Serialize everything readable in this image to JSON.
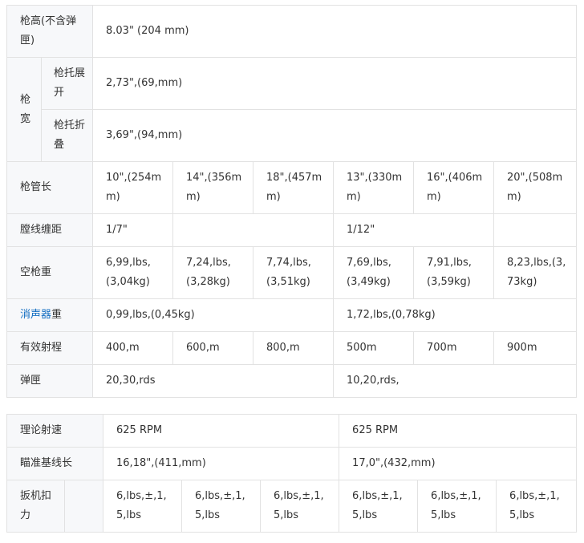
{
  "table1": {
    "height": {
      "label": "枪高(不含弹匣)",
      "value": "8.03\" (204 mm)"
    },
    "width": {
      "label": "枪宽",
      "stock_extended": {
        "label": "枪托展开",
        "value": "2,73\",(69,mm)"
      },
      "stock_folded": {
        "label": "枪托折叠",
        "value": "3,69\",(94,mm)"
      }
    },
    "barrel_length": {
      "label": "枪管长",
      "values": [
        "10\",(254mm)",
        "14\",(356mm)",
        "18\",(457mm)",
        "13\",(330mm)",
        "16\",(406mm)",
        "20\",(508mm)"
      ]
    },
    "twist_rate": {
      "label": "膛线缠距",
      "values": [
        "1/7\"",
        "",
        "1/12\"",
        ""
      ]
    },
    "empty_weight": {
      "label": "空枪重",
      "values": [
        "6,99,lbs,(3,04kg)",
        "7,24,lbs,(3,28kg)",
        "7,74,lbs,(3,51kg)",
        "7,69,lbs,(3,49kg)",
        "7,91,lbs,(3,59kg)",
        "8,23,lbs,(3,73kg)"
      ]
    },
    "suppressor_weight": {
      "label_link": "消声器",
      "label_rest": "重",
      "values": [
        "0,99,lbs,(0,45kg)",
        "1,72,lbs,(0,78kg)"
      ]
    },
    "effective_range": {
      "label": "有效射程",
      "values": [
        "400,m",
        "600,m",
        "800,m",
        "500m",
        "700m",
        "900m"
      ]
    },
    "magazine": {
      "label": "弹匣",
      "values": [
        "20,30,rds",
        "10,20,rds,"
      ]
    }
  },
  "table2": {
    "rate_of_fire": {
      "label": "理论射速",
      "values": [
        "625 RPM",
        "625 RPM"
      ]
    },
    "sight_radius": {
      "label": "瞄准基线长",
      "values": [
        "16,18\",(411,mm)",
        "17,0\",(432,mm)"
      ]
    },
    "trigger_pull": {
      "label": "扳机扣力",
      "values": [
        "6,lbs,±,1,5,lbs",
        "6,lbs,±,1,5,lbs",
        "6,lbs,±,1,5,lbs",
        "6,lbs,±,1,5,lbs",
        "6,lbs,±,1,5,lbs",
        "6,lbs,±,1,5,lbs"
      ]
    }
  },
  "colors": {
    "border": "#e2e2e2",
    "label_bg": "#f7f8fa",
    "text": "#333333",
    "link": "#136ec2"
  }
}
